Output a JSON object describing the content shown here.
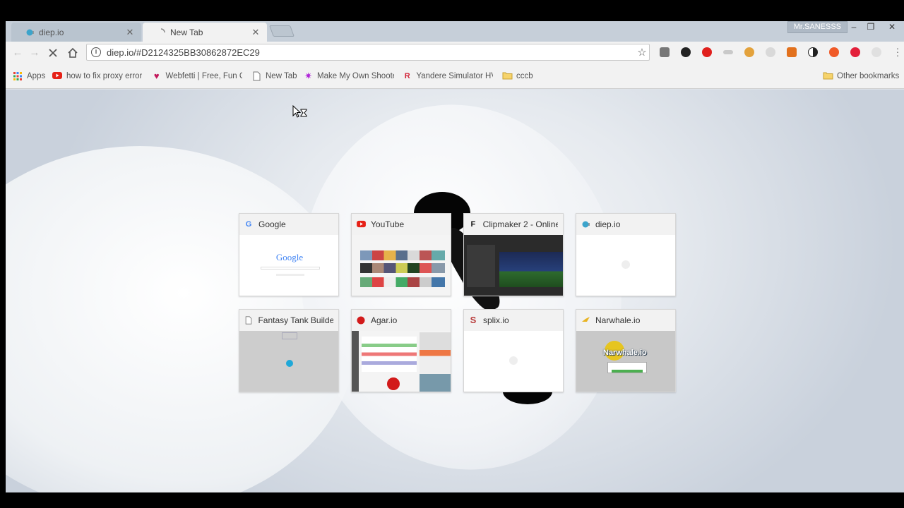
{
  "window": {
    "profile_name": "Mr.SANESSS",
    "controls": {
      "minimize": "‒",
      "restore": "❐",
      "close": "✕"
    }
  },
  "tabs": [
    {
      "label": "diep.io",
      "active": false,
      "favicon": "diep-icon"
    },
    {
      "label": "New Tab",
      "active": true,
      "favicon": "loading-icon"
    }
  ],
  "toolbar": {
    "url": "diep.io/#D2124325BB30862872EC29",
    "back_icon": "arrow-left-icon",
    "forward_icon": "arrow-right-icon",
    "stop_icon": "stop-icon",
    "home_icon": "home-icon"
  },
  "bookmarks": [
    {
      "label": "Apps",
      "icon": "apps-grid-icon"
    },
    {
      "label": "how to fix proxy error",
      "icon": "youtube-icon"
    },
    {
      "label": "Webfetti | Free, Fun C",
      "icon": "heart-icon"
    },
    {
      "label": "New Tab",
      "icon": "page-icon"
    },
    {
      "label": "Make My Own Shooter",
      "icon": "star-icon"
    },
    {
      "label": "Yandere Simulator HV",
      "icon": "roblox-icon"
    },
    {
      "label": "cccb",
      "icon": "folder-icon"
    }
  ],
  "other_bookmarks": "Other bookmarks",
  "most_visited": [
    {
      "title": "Google",
      "favicon": "google-icon"
    },
    {
      "title": "YouTube",
      "favicon": "youtube-icon"
    },
    {
      "title": "Clipmaker 2 - Online",
      "favicon": "clipmaker-icon"
    },
    {
      "title": "diep.io",
      "favicon": "diep-icon"
    },
    {
      "title": "Fantasy Tank Builder",
      "favicon": "page-icon"
    },
    {
      "title": "Agar.io",
      "favicon": "agar-icon"
    },
    {
      "title": "splix.io",
      "favicon": "splix-icon"
    },
    {
      "title": "Narwhale.io",
      "favicon": "narwhale-icon"
    }
  ],
  "thumbnails": {
    "google_logo": "Google",
    "narwhale_logo": "Narwhale.io"
  },
  "colors": {
    "accent_blue": "#4285f4",
    "youtube_red": "#e62117",
    "agar_red": "#d21a1a",
    "chrome_frame": "#c6cfd9",
    "toolbar": "#f2f2f2"
  }
}
